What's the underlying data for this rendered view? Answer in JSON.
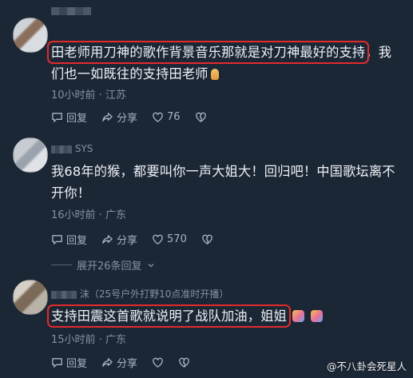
{
  "comments": [
    {
      "username": "",
      "text_highlight": "田老师用刀神的歌作背景音乐那就是对刀神最好的支持",
      "text_rest": "，我们也一如既往的支持田老师",
      "emoji": "hand-icon",
      "time": "10小时前",
      "location": "江苏",
      "reply_label": "回复",
      "share_label": "分享",
      "like_count": "76"
    },
    {
      "username": "SYS",
      "text": "我68年的猴，都要叫你一声大姐大！回归吧！中国歌坛离不开你！",
      "time": "16小时前",
      "location": "广东",
      "reply_label": "回复",
      "share_label": "分享",
      "like_count": "570",
      "expand_label": "展开26条回复"
    },
    {
      "username": "沫（25号户外打野10点准时开播）",
      "text_highlight": "支持田震这首歌就说明了战队加油，姐姐",
      "emoji": "party-emoji",
      "time": "15小时前",
      "location": "广东",
      "reply_label": "回复",
      "share_label": "分享"
    }
  ],
  "meta_separator": "·",
  "watermark": "@不八卦会死星人",
  "colors": {
    "background": "#1c2736",
    "highlight_box": "#e12b2b",
    "muted_text": "#8391a3"
  }
}
